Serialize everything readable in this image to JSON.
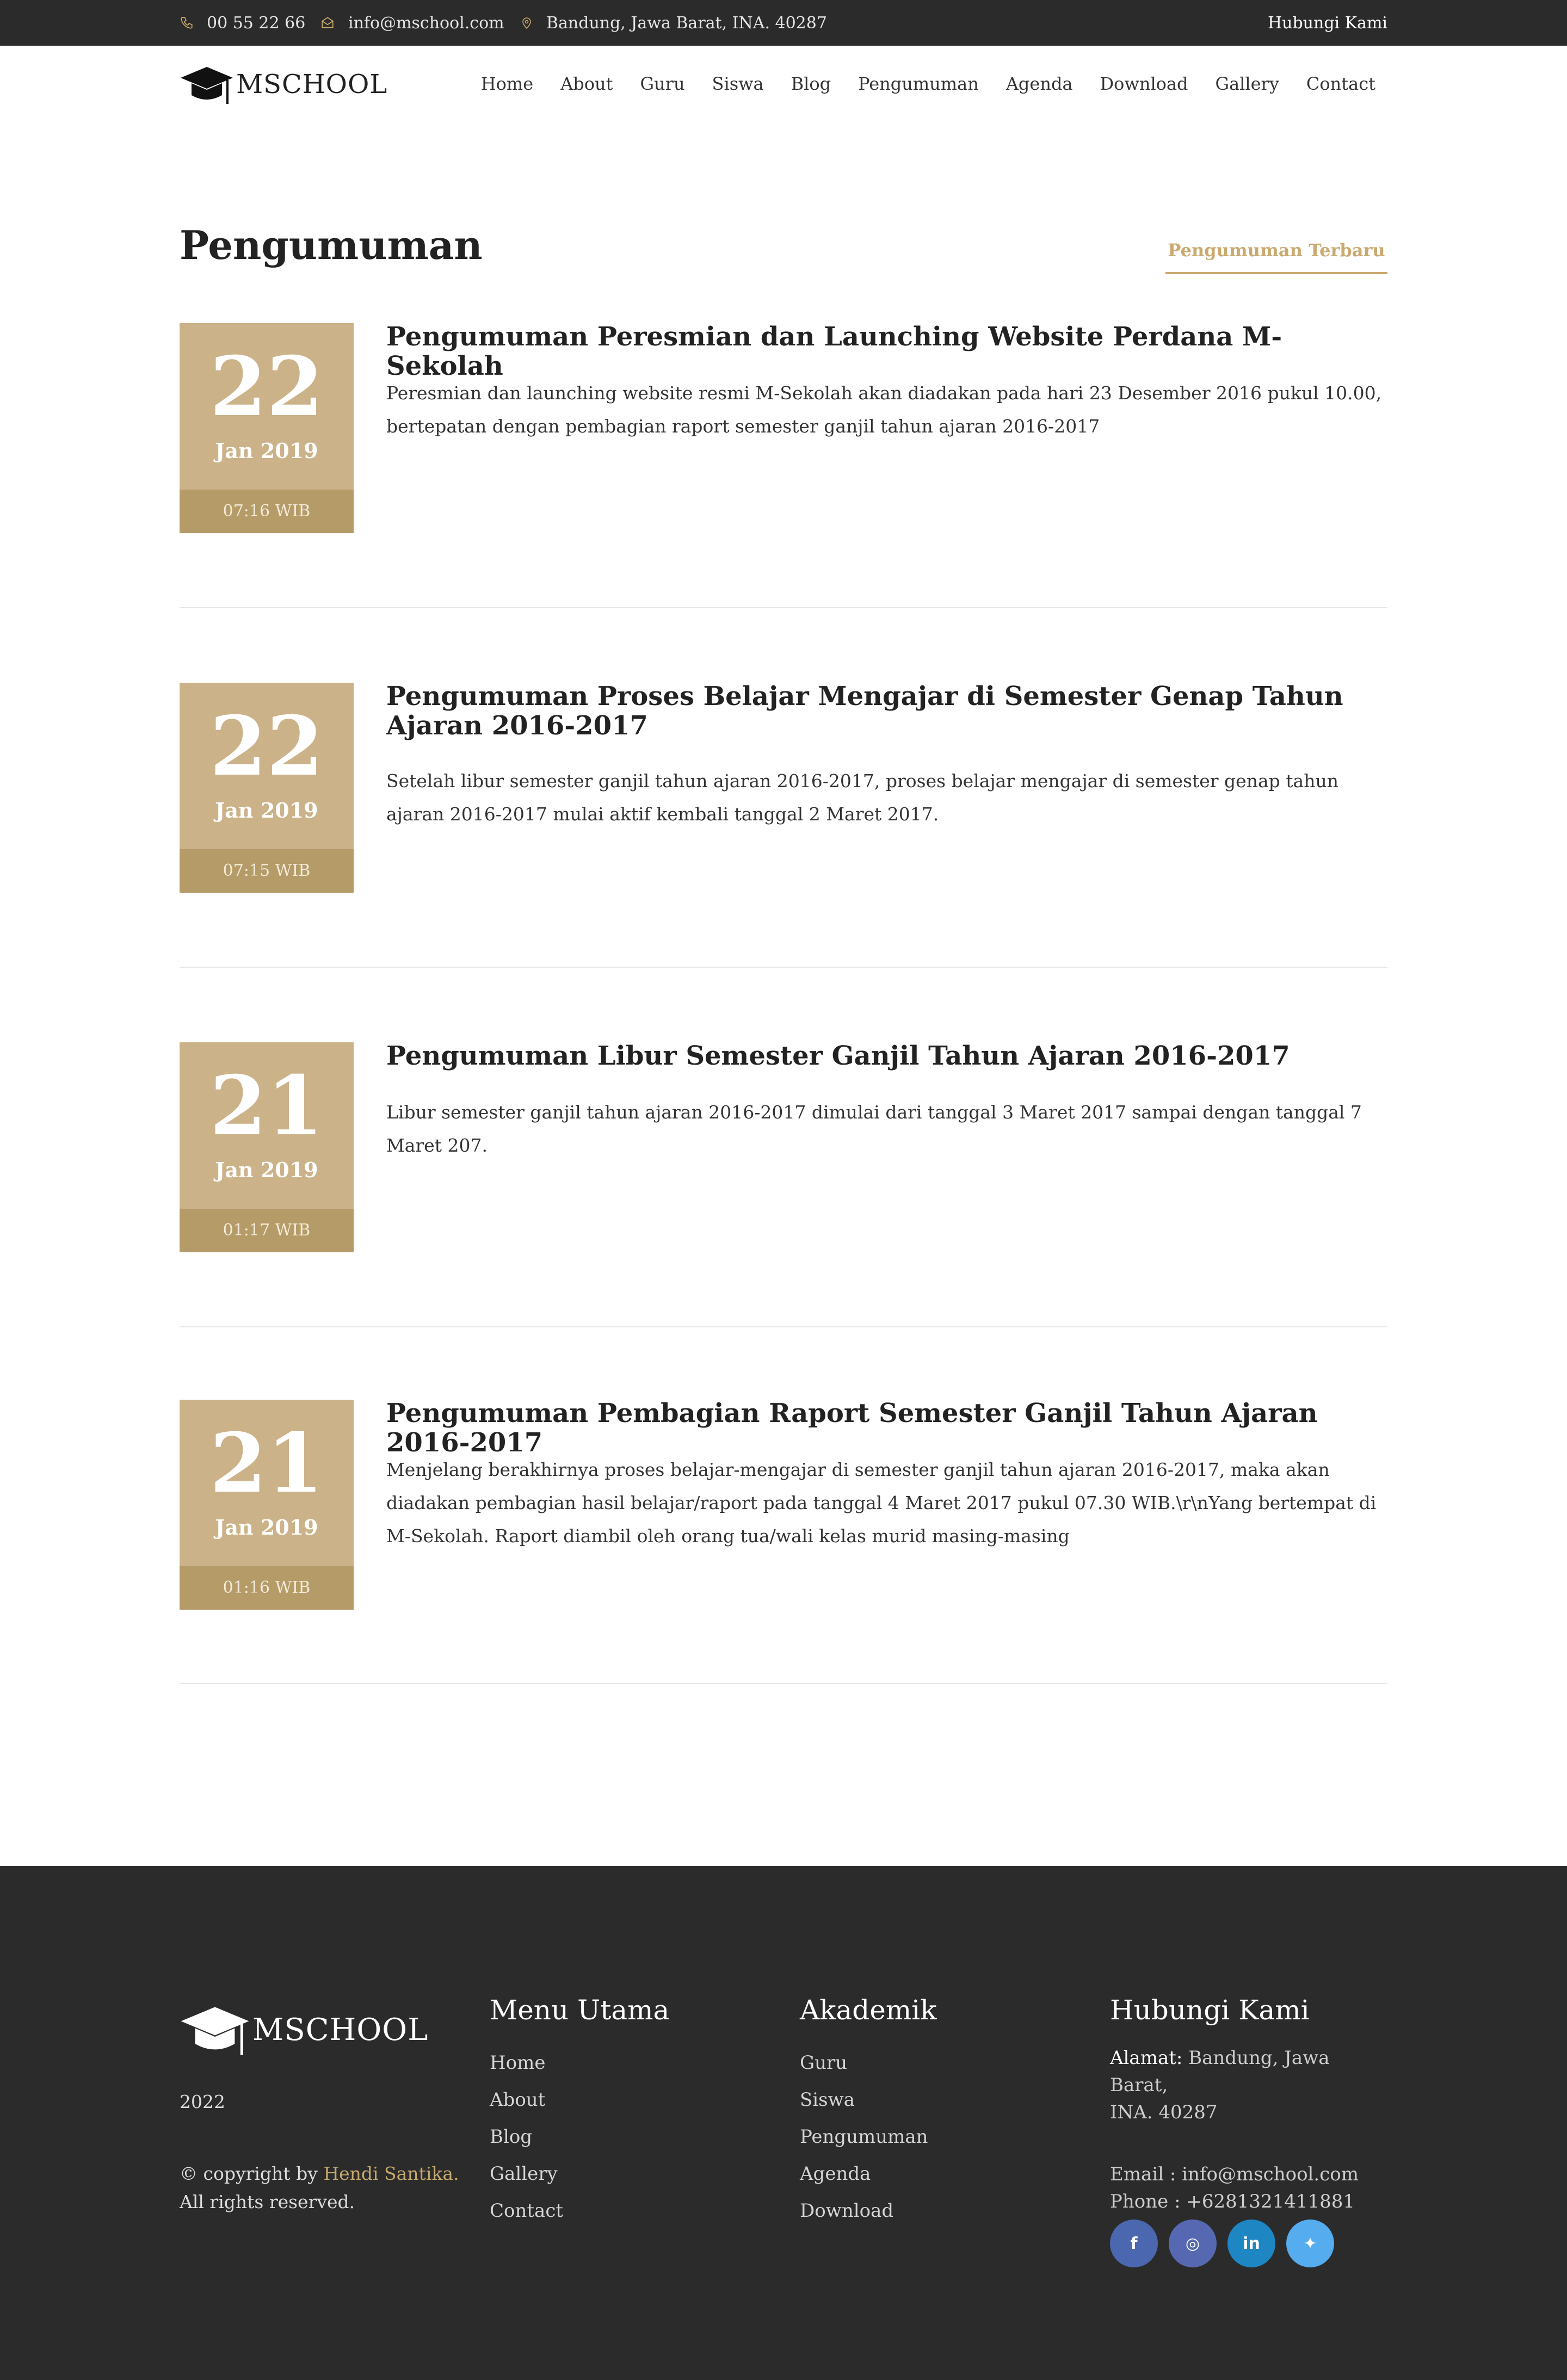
{
  "topbar": {
    "phone": "00 55 22 66",
    "email": "info@mschool.com",
    "address": "Bandung, Jawa Barat, INA. 40287",
    "contact_label": "Hubungi Kami"
  },
  "brand": {
    "name": "MSCHOOL"
  },
  "nav": [
    "Home",
    "About",
    "Guru",
    "Siswa",
    "Blog",
    "Pengumuman",
    "Agenda",
    "Download",
    "Gallery",
    "Contact"
  ],
  "page": {
    "title": "Pengumuman",
    "active_tab": "Pengumuman Terbaru"
  },
  "announcements": [
    {
      "day": "22",
      "month": "Jan 2019",
      "time": "07:16 WIB",
      "title": "Pengumuman Peresmian dan Launching Website Perdana M-Sekolah",
      "body": "Peresmian dan launching website resmi M-Sekolah akan diadakan pada hari 23 Desember 2016 pukul 10.00, bertepatan dengan pembagian raport semester ganjil tahun ajaran 2016-2017"
    },
    {
      "day": "22",
      "month": "Jan 2019",
      "time": "07:15 WIB",
      "title": "Pengumuman Proses Belajar Mengajar di Semester Genap Tahun Ajaran 2016-2017",
      "body": "Setelah libur semester ganjil tahun ajaran 2016-2017, proses belajar mengajar di semester genap tahun ajaran 2016-2017 mulai aktif kembali tanggal 2 Maret 2017."
    },
    {
      "day": "21",
      "month": "Jan 2019",
      "time": "01:17 WIB",
      "title": "Pengumuman Libur Semester Ganjil Tahun Ajaran 2016-2017",
      "body": "Libur semester ganjil tahun ajaran 2016-2017 dimulai dari tanggal 3 Maret 2017 sampai dengan tanggal 7 Maret 207."
    },
    {
      "day": "21",
      "month": "Jan 2019",
      "time": "01:16 WIB",
      "title": "Pengumuman Pembagian Raport Semester Ganjil Tahun Ajaran 2016-2017",
      "body": "Menjelang berakhirnya proses belajar-mengajar di semester ganjil tahun ajaran 2016-2017, maka akan diadakan pembagian hasil belajar/raport pada tanggal 4 Maret 2017 pukul 07.30 WIB.\\r\\nYang bertempat di M-Sekolah. Raport diambil oleh orang tua/wali kelas murid masing-masing"
    }
  ],
  "footer": {
    "year": "2022",
    "copyright_prefix": "© copyright by ",
    "copyright_author": "Hendi Santika.",
    "rights": "All rights reserved.",
    "menu_title": "Menu Utama",
    "menu": [
      "Home",
      "About",
      "Blog",
      "Gallery",
      "Contact"
    ],
    "akademik_title": "Akademik",
    "akademik": [
      "Guru",
      "Siswa",
      "Pengumuman",
      "Agenda",
      "Download"
    ],
    "contact_title": "Hubungi Kami",
    "address_label": "Alamat:",
    "address_line1": " Bandung, Jawa Barat,",
    "address_line2": "INA. 40287",
    "email_line": "Email : info@mschool.com",
    "phone_line": "Phone : +6281321411881",
    "socials": [
      {
        "icon": "facebook-icon",
        "glyph": "f",
        "color": "#4b67b0"
      },
      {
        "icon": "instagram-icon",
        "glyph": "◎",
        "color": "#5768b3"
      },
      {
        "icon": "linkedin-icon",
        "glyph": "in",
        "color": "#1f86c4"
      },
      {
        "icon": "twitter-icon",
        "glyph": "✦",
        "color": "#55acee"
      }
    ]
  },
  "colors": {
    "accent": "#c9a96e",
    "date_box": "#cbb288",
    "date_time": "#b59b67",
    "dark": "#2b2b2b"
  }
}
